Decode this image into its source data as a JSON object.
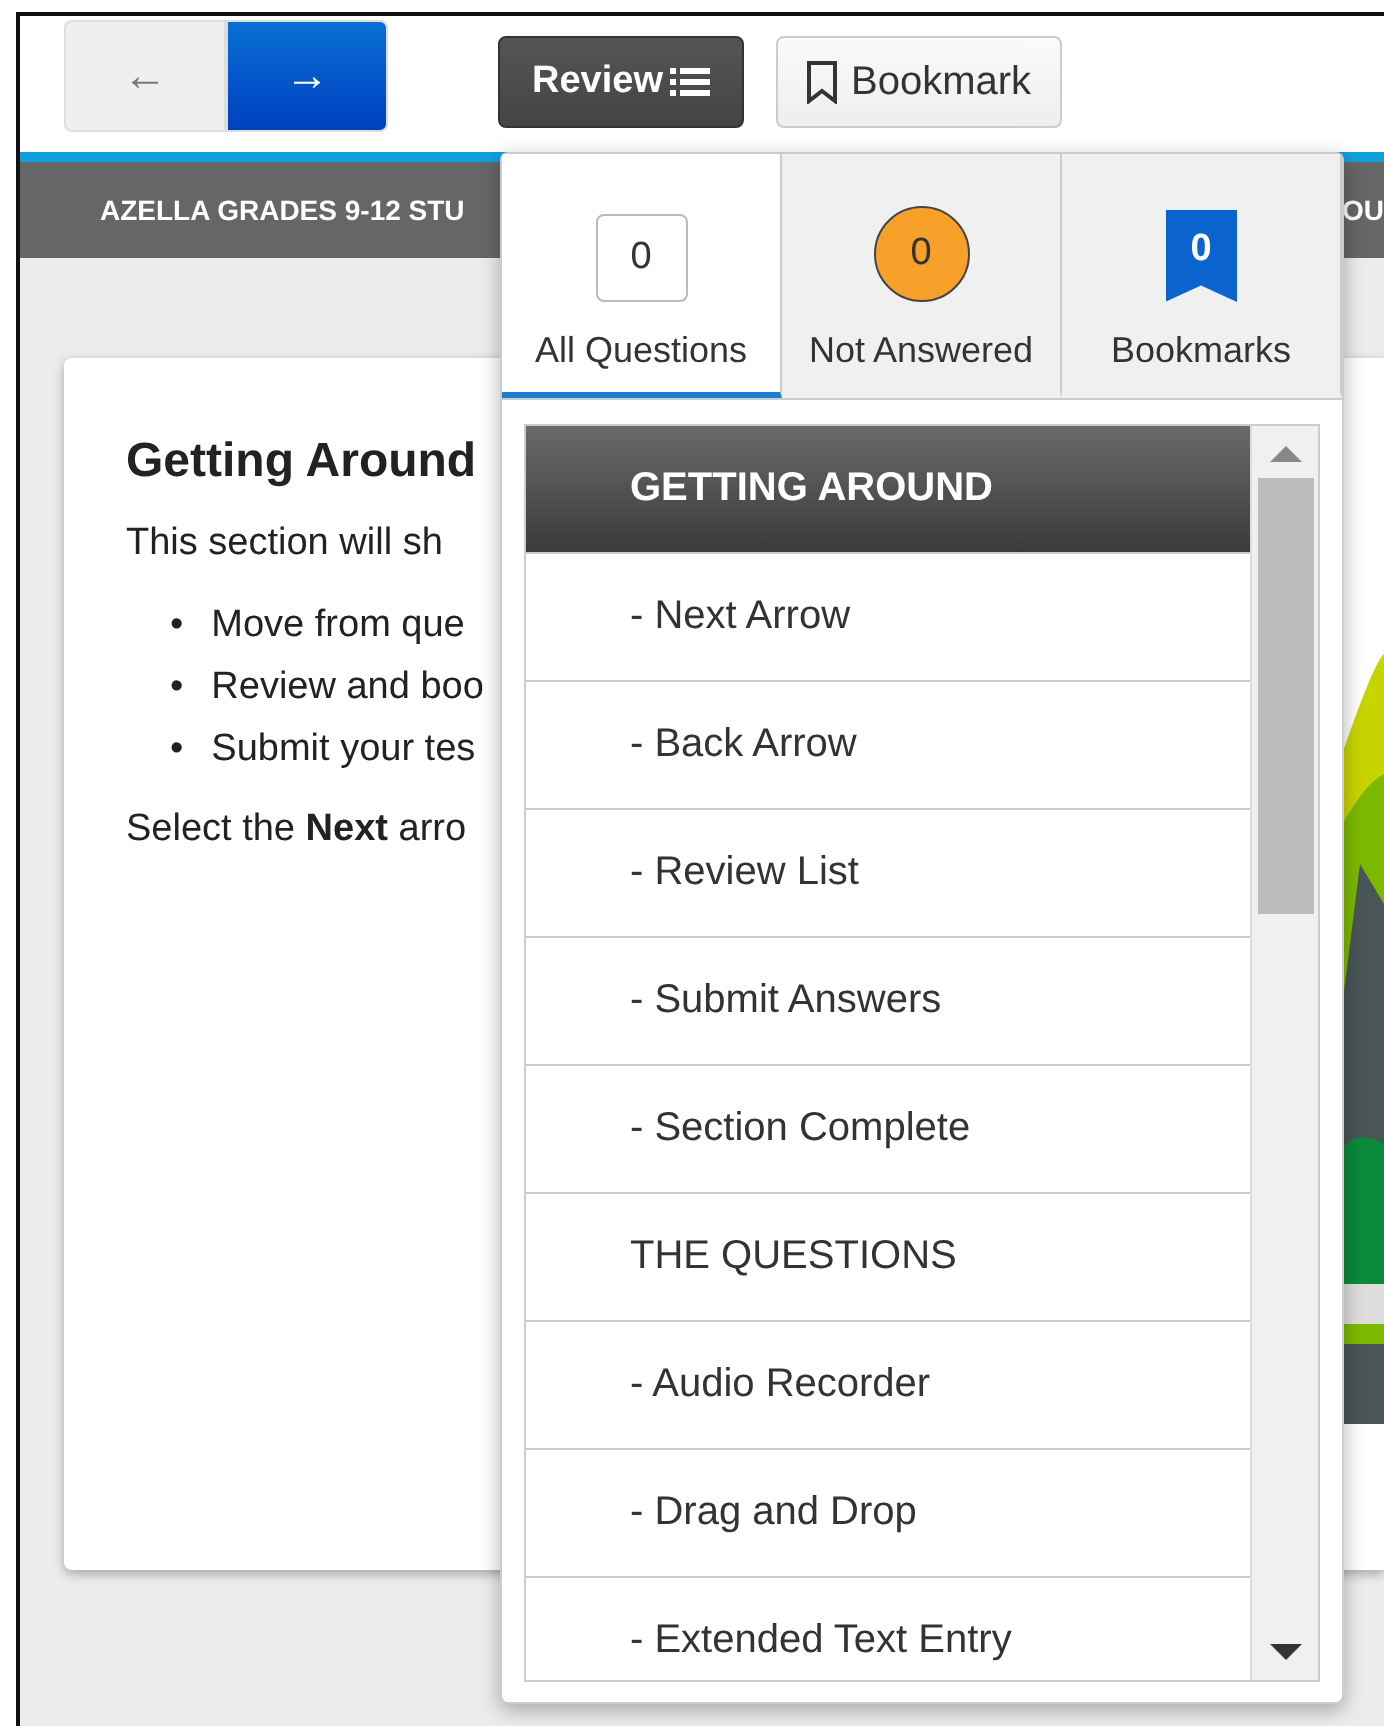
{
  "toolbar": {
    "back_button": {
      "label": "←",
      "disabled": true
    },
    "next_button": {
      "label": "→",
      "disabled": false
    },
    "review_button": {
      "label": "Review",
      "selected": true
    },
    "bookmark_button": {
      "label": "Bookmark"
    }
  },
  "header": {
    "left": "AZELLA GRADES 9-12 STU",
    "right": "OU"
  },
  "content": {
    "title": "Getting Around",
    "intro": "This section will sh",
    "bullets": [
      {
        "marker": "•",
        "text": "Move from que"
      },
      {
        "marker": "•",
        "text": "Review and boo"
      },
      {
        "marker": "•",
        "text": "Submit your tes"
      }
    ],
    "instruction": "Select the **Next** arro"
  },
  "review_panel": {
    "tabs": [
      {
        "label": "All Questions",
        "count": "0",
        "kind": "box",
        "selected": true
      },
      {
        "label": "Not Answered",
        "count": "0",
        "kind": "circle",
        "selected": false
      },
      {
        "label": "Bookmarks",
        "count": "0",
        "kind": "flag",
        "selected": false
      }
    ],
    "items": [
      {
        "label": "GETTING AROUND",
        "kind": "section",
        "selected": true
      },
      {
        "label": "- Next Arrow",
        "kind": "question",
        "selected": false
      },
      {
        "label": "- Back Arrow",
        "kind": "question",
        "selected": false
      },
      {
        "label": "- Review List",
        "kind": "question",
        "selected": false
      },
      {
        "label": "- Submit Answers",
        "kind": "question",
        "selected": false
      },
      {
        "label": "- Section Complete",
        "kind": "question",
        "selected": false
      },
      {
        "label": "THE QUESTIONS",
        "kind": "section",
        "selected": false
      },
      {
        "label": "- Audio Recorder",
        "kind": "question",
        "selected": false
      },
      {
        "label": "- Drag and Drop",
        "kind": "question",
        "selected": false
      },
      {
        "label": "- Extended Text Entry",
        "kind": "question",
        "selected": false
      }
    ]
  }
}
